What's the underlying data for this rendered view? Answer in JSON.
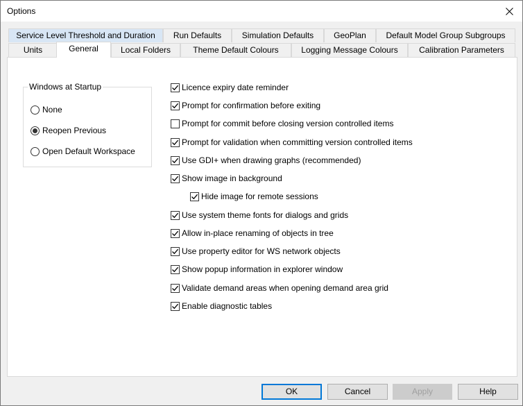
{
  "window": {
    "title": "Options"
  },
  "tabs_top": [
    {
      "label": "Service Level Threshold and Duration"
    },
    {
      "label": "Run Defaults"
    },
    {
      "label": "Simulation Defaults"
    },
    {
      "label": "GeoPlan"
    },
    {
      "label": "Default Model Group Subgroups"
    }
  ],
  "tabs_bottom": [
    {
      "label": "Units"
    },
    {
      "label": "General"
    },
    {
      "label": "Local Folders"
    },
    {
      "label": "Theme Default Colours"
    },
    {
      "label": "Logging Message Colours"
    },
    {
      "label": "Calibration Parameters"
    }
  ],
  "selected_tab": "General",
  "startup": {
    "label": "Windows at Startup",
    "options": [
      {
        "label": "None",
        "checked": false
      },
      {
        "label": "Reopen Previous",
        "checked": true
      },
      {
        "label": "Open Default Workspace",
        "checked": false
      }
    ]
  },
  "checkboxes": [
    {
      "label": "Licence expiry date reminder",
      "checked": true
    },
    {
      "label": "Prompt for confirmation before exiting",
      "checked": true
    },
    {
      "label": "Prompt for commit before closing version controlled items",
      "checked": false
    },
    {
      "label": "Prompt for validation when committing version controlled items",
      "checked": true
    },
    {
      "label": "Use GDI+ when drawing graphs (recommended)",
      "checked": true
    },
    {
      "label": "Show image in background",
      "checked": true
    },
    {
      "label": "Hide image for remote sessions",
      "checked": true
    },
    {
      "label": "Use system theme fonts for dialogs and grids",
      "checked": true
    },
    {
      "label": "Allow in-place renaming of objects in tree",
      "checked": true
    },
    {
      "label": "Use property editor for WS network objects",
      "checked": true
    },
    {
      "label": "Show popup information in explorer window",
      "checked": true
    },
    {
      "label": "Validate demand areas when opening demand area grid",
      "checked": true
    },
    {
      "label": "Enable diagnostic tables",
      "checked": true
    }
  ],
  "buttons": {
    "ok": "OK",
    "cancel": "Cancel",
    "apply": "Apply",
    "help": "Help"
  }
}
